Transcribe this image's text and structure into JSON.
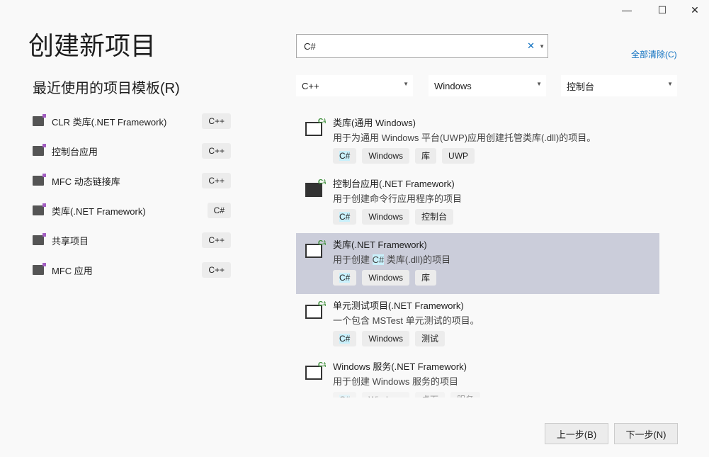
{
  "window": {
    "minimize": "—",
    "maximize": "☐",
    "close": "✕"
  },
  "title": "创建新项目",
  "recent": {
    "title": "最近使用的项目模板(R)",
    "items": [
      {
        "label": "CLR 类库(.NET Framework)",
        "lang": "C++"
      },
      {
        "label": "控制台应用",
        "lang": "C++"
      },
      {
        "label": "MFC 动态链接库",
        "lang": "C++"
      },
      {
        "label": "类库(.NET Framework)",
        "lang": "C#"
      },
      {
        "label": "共享项目",
        "lang": "C++"
      },
      {
        "label": "MFC 应用",
        "lang": "C++"
      }
    ]
  },
  "search": {
    "value": "C#",
    "clear": "✕",
    "clear_all": "全部清除(C)"
  },
  "filters": {
    "language": "C++",
    "platform": "Windows",
    "type": "控制台"
  },
  "templates": [
    {
      "name": "类库(通用 Windows)",
      "desc": "用于为通用 Windows 平台(UWP)应用创建托管类库(.dll)的项目。",
      "tags": [
        "C#",
        "Windows",
        "库",
        "UWP"
      ]
    },
    {
      "name": "控制台应用(.NET Framework)",
      "desc": "用于创建命令行应用程序的项目",
      "tags": [
        "C#",
        "Windows",
        "控制台"
      ]
    },
    {
      "name": "类库(.NET Framework)",
      "desc_pre": "用于创建 ",
      "desc_hl": "C#",
      "desc_post": " 类库(.dll)的项目",
      "tags": [
        "C#",
        "Windows",
        "库"
      ]
    },
    {
      "name": "单元测试项目(.NET Framework)",
      "desc": "一个包含 MSTest 单元测试的项目。",
      "tags": [
        "C#",
        "Windows",
        "测试"
      ]
    },
    {
      "name": "Windows 服务(.NET Framework)",
      "desc": "用于创建 Windows 服务的项目",
      "tags": [
        "C#",
        "Windows",
        "桌面",
        "服务"
      ]
    }
  ],
  "buttons": {
    "back": "上一步(B)",
    "next": "下一步(N)"
  },
  "colors": {
    "selected": "#cbcdda",
    "link": "#0e70c0",
    "highlight": "#c9f0fb"
  }
}
